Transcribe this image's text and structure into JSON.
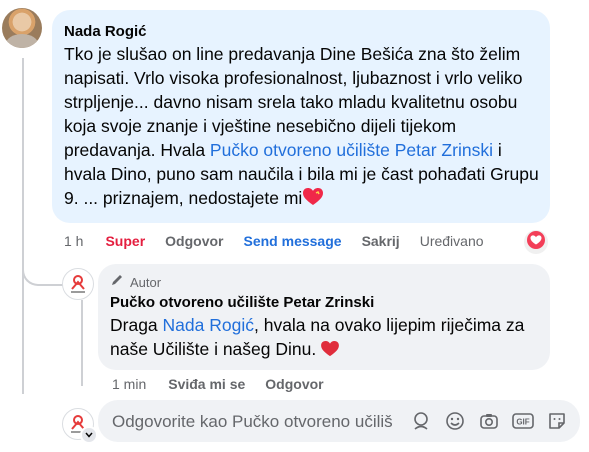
{
  "comment": {
    "author": "Nada Rogić",
    "text_before_link": "Tko je slušao on line predavanja Dine Bešića zna što želim napisati. Vrlo visoka profesionalnost, ljubaznost i vrlo veliko strpljenje... davno nisam srela tako mladu kvalitetnu osobu koja svoje znanje i vještine nesebično dijeli tijekom predavanja. Hvala ",
    "link_text": "Pučko otvoreno učilište Petar Zrinski",
    "text_after_link": " i hvala Dino, puno sam naučila i bila mi je čast pohađati Grupu 9. ... priznajem, nedostajete mi",
    "end_emoji": "heart-icon",
    "time": "1 h",
    "reaction_label": "Super",
    "reply_label": "Odgovor",
    "send_message_label": "Send message",
    "hide_label": "Sakrij",
    "edited_label": "Uređivano",
    "reaction_badge": "heart",
    "colors": {
      "bubble": "#e7f3ff",
      "link": "#216fdb",
      "reaction": "#e41e3f",
      "heart": "#f02849"
    }
  },
  "reply": {
    "badge": "Autor",
    "author": "Pučko otvoreno učilište Petar Zrinski",
    "text_before_mention": "Draga ",
    "mention": "Nada Rogić",
    "text_after_mention": ", hvala na ovako lijepim riječima za naše Učilište i našeg Dinu.",
    "end_emoji": "heart-icon",
    "time": "1 min",
    "like_label": "Sviđa mi se",
    "reply_label": "Odgovor",
    "colors": {
      "bubble": "#f0f2f5"
    }
  },
  "composer": {
    "placeholder": "Odgovorite kao Pučko otvoreno učilište Petar Zrinski",
    "tools": [
      "avatar-sticker-icon",
      "emoji-icon",
      "camera-icon",
      "gif-icon",
      "sticker-icon"
    ]
  }
}
